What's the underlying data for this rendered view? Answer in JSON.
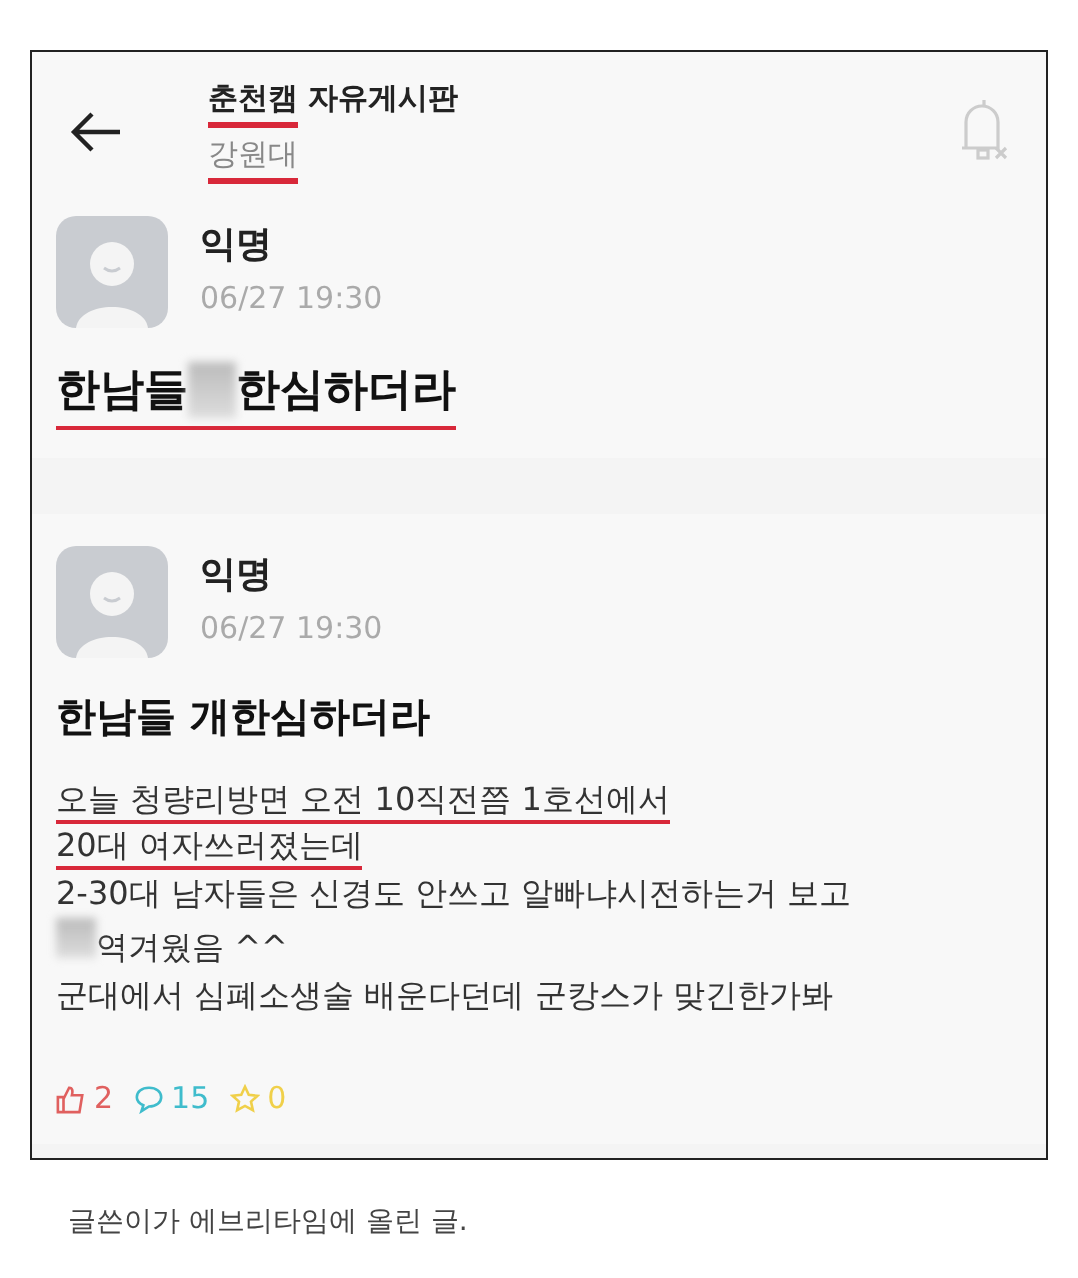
{
  "header": {
    "title_parts": [
      {
        "text": "춘천캠",
        "underlined": true
      },
      {
        "text": "자유게시판",
        "underlined": false
      }
    ],
    "subtitle": {
      "text": "강원대",
      "underlined": true
    }
  },
  "posts": [
    {
      "author": "익명",
      "time": "06/27 19:30",
      "title": {
        "underlined": true,
        "segments": [
          {
            "kind": "text",
            "text": "한남들 "
          },
          {
            "kind": "censor"
          },
          {
            "kind": "text",
            "text": "한심하더라"
          }
        ]
      }
    },
    {
      "author": "익명",
      "time": "06/27 19:30",
      "title": {
        "underlined": false,
        "segments": [
          {
            "kind": "text",
            "text": "한남들 개한심하더라"
          }
        ]
      },
      "lines": [
        {
          "underlined": true,
          "segments": [
            {
              "kind": "text",
              "text": "오늘 청량리방면 오전 10직전쯤 1호선에서"
            }
          ]
        },
        {
          "underlined": true,
          "segments": [
            {
              "kind": "text",
              "text": "20대 여자쓰러졌는데"
            }
          ]
        },
        {
          "underlined": false,
          "segments": [
            {
              "kind": "text",
              "text": "2-30대 남자들은 신경도 안쓰고 알빠냐시전하는거 보고"
            }
          ]
        },
        {
          "underlined": false,
          "segments": [
            {
              "kind": "censor"
            },
            {
              "kind": "text",
              "text": "역겨웠음 ^^"
            }
          ]
        },
        {
          "underlined": false,
          "segments": [
            {
              "kind": "text",
              "text": "군대에서 심폐소생술 배운다던데 군캉스가 맞긴한가봐"
            }
          ]
        }
      ],
      "reactions": [
        {
          "kind": "like",
          "count": "2",
          "color": "#e0605f"
        },
        {
          "kind": "comment",
          "count": "15",
          "color": "#3fbccc"
        },
        {
          "kind": "scrap",
          "count": "0",
          "color": "#f0d04a"
        }
      ]
    }
  ],
  "caption": "글쓴이가 에브리타임에 올린 글."
}
